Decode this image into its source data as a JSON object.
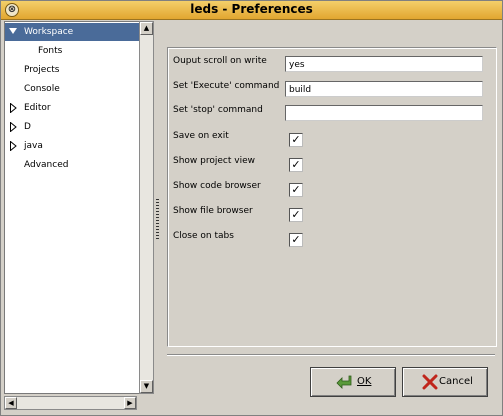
{
  "window": {
    "title": "leds - Preferences"
  },
  "tree": {
    "items": [
      {
        "label": "Workspace",
        "expanded": true,
        "selected": true
      },
      {
        "label": "Fonts",
        "child": true
      },
      {
        "label": "Projects"
      },
      {
        "label": "Console"
      },
      {
        "label": "Editor",
        "collapsed": true
      },
      {
        "label": "D",
        "collapsed": true
      },
      {
        "label": "java",
        "collapsed": true
      },
      {
        "label": "Advanced"
      }
    ]
  },
  "form": {
    "output_scroll": {
      "label": "Ouput scroll on write",
      "value": "yes"
    },
    "execute_command": {
      "label": "Set 'Execute' command",
      "value": "build"
    },
    "stop_command": {
      "label": "Set 'stop' command",
      "value": ""
    },
    "save_on_exit": {
      "label": "Save on exit",
      "checked": true
    },
    "show_project_view": {
      "label": "Show project view",
      "checked": true
    },
    "show_code_browser": {
      "label": "Show code browser",
      "checked": true
    },
    "show_file_browser": {
      "label": "Show file browser",
      "checked": true
    },
    "close_on_tabs": {
      "label": "Close on tabs",
      "checked": true
    }
  },
  "buttons": {
    "ok": {
      "label": "OK",
      "icon": "green-arrow-icon"
    },
    "cancel": {
      "label": "Cancel",
      "icon": "red-x-icon"
    }
  },
  "colors": {
    "selection": "#4a6b99",
    "titlebar": "#e8b446"
  }
}
